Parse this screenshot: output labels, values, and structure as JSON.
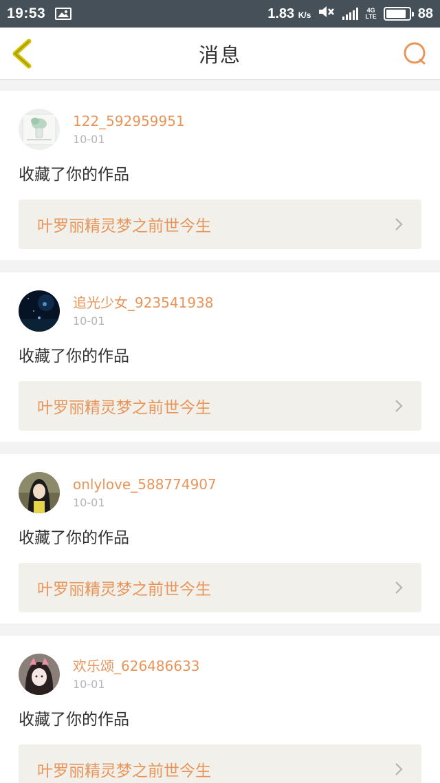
{
  "status_bar": {
    "time": "19:53",
    "speed_value": "1.83",
    "speed_unit": "K/s",
    "network": "4G",
    "network_sub": "LTE",
    "battery": "88",
    "battery_level": 0.88
  },
  "nav": {
    "title": "消息",
    "accent_color": "#e8955a"
  },
  "messages": [
    {
      "username": "122_592959951",
      "date": "10-01",
      "action": "收藏了你的作品",
      "work_title": "叶罗丽精灵梦之前世今生"
    },
    {
      "username": "追光少女_923541938",
      "date": "10-01",
      "action": "收藏了你的作品",
      "work_title": "叶罗丽精灵梦之前世今生"
    },
    {
      "username": "onlylove_588774907",
      "date": "10-01",
      "action": "收藏了你的作品",
      "work_title": "叶罗丽精灵梦之前世今生"
    },
    {
      "username": "欢乐颂_626486633",
      "date": "10-01",
      "action": "收藏了你的作品",
      "work_title": "叶罗丽精灵梦之前世今生"
    }
  ]
}
